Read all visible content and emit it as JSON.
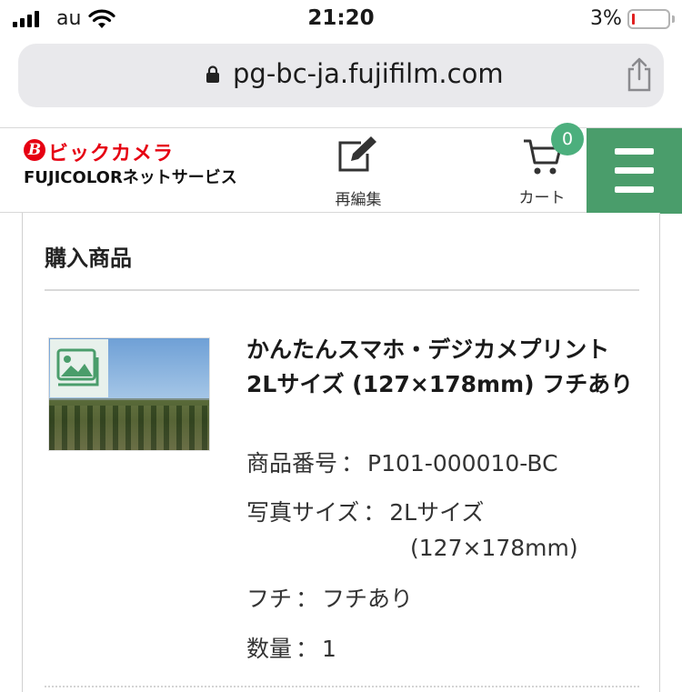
{
  "status_bar": {
    "carrier": "au",
    "time": "21:20",
    "battery_percent": "3%",
    "battery_level": 0.03,
    "battery_color": "#e02020"
  },
  "browser": {
    "url": "pg-bc-ja.fujifilm.com",
    "lock_icon": "lock-icon",
    "share_icon": "share-icon"
  },
  "header": {
    "brand_name": "ビックカメラ",
    "brand_service": "FUJICOLORネットサービス",
    "reedit_label": "再編集",
    "cart_label": "カート",
    "cart_count": "0",
    "accent_color": "#4a9d6b",
    "menu_icon": "hamburger-menu-icon"
  },
  "purchase": {
    "section_title": "購入商品",
    "item": {
      "name": "かんたんスマホ・デジカメプリント 2Lサイズ (127×178mm) フチあり",
      "photo_badge_icon": "image-gallery-icon",
      "specs": [
        {
          "label": "商品番号",
          "separator": "：",
          "value": "P101-000010-BC"
        },
        {
          "label": "写真サイズ",
          "separator": "：",
          "value": "2Lサイズ",
          "sub_value": "(127×178mm)"
        },
        {
          "label": "フチ",
          "separator": "：",
          "value": "フチあり"
        },
        {
          "label": "数量",
          "separator": "：",
          "value": "1"
        }
      ]
    }
  }
}
